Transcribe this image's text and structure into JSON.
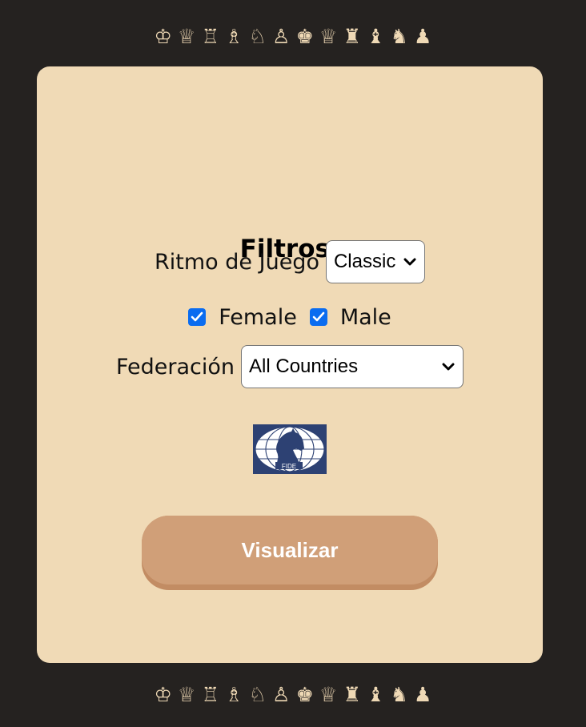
{
  "decor": {
    "pieces_top": [
      "♔",
      "♕",
      "♖",
      "♗",
      "♘",
      "♙",
      "♚",
      "♕",
      "♜",
      "♝",
      "♞",
      "♟"
    ],
    "pieces_bottom": [
      "♔",
      "♕",
      "♖",
      "♗",
      "♘",
      "♙",
      "♚",
      "♕",
      "♜",
      "♝",
      "♞",
      "♟"
    ],
    "piece_color": "#efd9b5"
  },
  "colors": {
    "background": "#252220",
    "card": "#f0dab6",
    "button": "#d09f78",
    "button_shadow": "#c28c63",
    "checkbox": "#0a6cf0",
    "logo_blue": "#2d4173"
  },
  "filters": {
    "title": "Filtros:",
    "ritmo_label": "Ritmo de Juego",
    "ritmo_value": "Classic",
    "female_label": "Female",
    "female_checked": true,
    "male_label": "Male",
    "male_checked": true,
    "federacion_label": "Federación",
    "federacion_value": "All Countries"
  },
  "logo": {
    "text": "FIDE",
    "icon": "fide-knight-logo"
  },
  "button": {
    "label": "Visualizar"
  }
}
